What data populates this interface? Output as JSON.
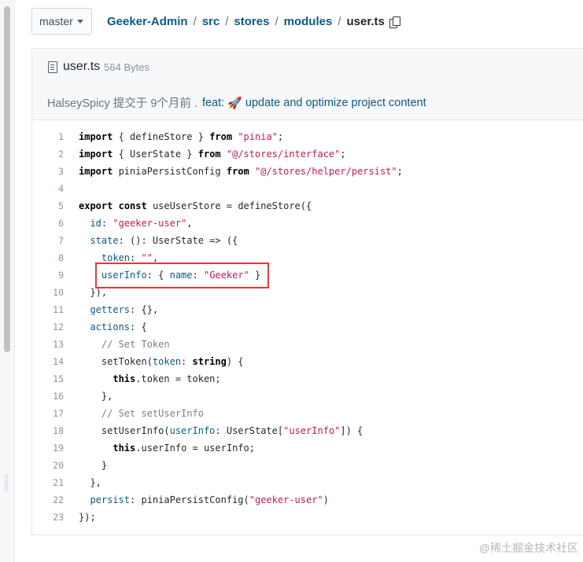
{
  "branch": {
    "label": "master"
  },
  "breadcrumb": [
    "Geeker-Admin",
    "src",
    "stores",
    "modules"
  ],
  "breadcrumb_current": "user.ts",
  "file": {
    "name": "user.ts",
    "size": "564 Bytes"
  },
  "commit": {
    "prefix": "HalseySpicy 提交于 9个月前 .",
    "type": "feat:",
    "emoji": "🚀",
    "message": "update and optimize project content"
  },
  "code": {
    "line_numbers": [
      "1",
      "2",
      "3",
      "4",
      "5",
      "6",
      "7",
      "8",
      "9",
      "10",
      "11",
      "12",
      "13",
      "14",
      "15",
      "16",
      "17",
      "18",
      "19",
      "20",
      "21",
      "22",
      "23"
    ],
    "lines": [
      [
        [
          "k",
          "import"
        ],
        [
          "t",
          " { defineStore } "
        ],
        [
          "k",
          "from"
        ],
        [
          "t",
          " "
        ],
        [
          "s",
          "\"pinia\""
        ],
        [
          "t",
          ";"
        ]
      ],
      [
        [
          "k",
          "import"
        ],
        [
          "t",
          " { UserState } "
        ],
        [
          "k",
          "from"
        ],
        [
          "t",
          " "
        ],
        [
          "s",
          "\"@/stores/interface\""
        ],
        [
          "t",
          ";"
        ]
      ],
      [
        [
          "k",
          "import"
        ],
        [
          "t",
          " piniaPersistConfig "
        ],
        [
          "k",
          "from"
        ],
        [
          "t",
          " "
        ],
        [
          "s",
          "\"@/stores/helper/persist\""
        ],
        [
          "t",
          ";"
        ]
      ],
      [],
      [
        [
          "k",
          "export"
        ],
        [
          "t",
          " "
        ],
        [
          "k",
          "const"
        ],
        [
          "t",
          " useUserStore = defineStore({"
        ]
      ],
      [
        [
          "t",
          "  "
        ],
        [
          "p",
          "id"
        ],
        [
          "t",
          ": "
        ],
        [
          "s",
          "\"geeker-user\""
        ],
        [
          "t",
          ","
        ]
      ],
      [
        [
          "t",
          "  "
        ],
        [
          "p",
          "state"
        ],
        [
          "t",
          ": (): UserState => ({"
        ]
      ],
      [
        [
          "t",
          "    "
        ],
        [
          "p",
          "token"
        ],
        [
          "t",
          ": "
        ],
        [
          "s",
          "\"\""
        ],
        [
          "t",
          ","
        ]
      ],
      [
        [
          "t",
          "    "
        ],
        [
          "p",
          "userInfo"
        ],
        [
          "t",
          ": { "
        ],
        [
          "p",
          "name"
        ],
        [
          "t",
          ": "
        ],
        [
          "s",
          "\"Geeker\""
        ],
        [
          "t",
          " }"
        ]
      ],
      [
        [
          "t",
          "  }),"
        ]
      ],
      [
        [
          "t",
          "  "
        ],
        [
          "p",
          "getters"
        ],
        [
          "t",
          ": {},"
        ]
      ],
      [
        [
          "t",
          "  "
        ],
        [
          "p",
          "actions"
        ],
        [
          "t",
          ": {"
        ]
      ],
      [
        [
          "t",
          "    "
        ],
        [
          "c",
          "// Set Token"
        ]
      ],
      [
        [
          "t",
          "    setToken("
        ],
        [
          "p",
          "token"
        ],
        [
          "t",
          ": "
        ],
        [
          "k",
          "string"
        ],
        [
          "t",
          ") {"
        ]
      ],
      [
        [
          "t",
          "      "
        ],
        [
          "k",
          "this"
        ],
        [
          "t",
          ".token = token;"
        ]
      ],
      [
        [
          "t",
          "    },"
        ]
      ],
      [
        [
          "t",
          "    "
        ],
        [
          "c",
          "// Set setUserInfo"
        ]
      ],
      [
        [
          "t",
          "    setUserInfo("
        ],
        [
          "p",
          "userInfo"
        ],
        [
          "t",
          ": UserState["
        ],
        [
          "s",
          "\"userInfo\""
        ],
        [
          "t",
          "]) {"
        ]
      ],
      [
        [
          "t",
          "      "
        ],
        [
          "k",
          "this"
        ],
        [
          "t",
          ".userInfo = userInfo;"
        ]
      ],
      [
        [
          "t",
          "    }"
        ]
      ],
      [
        [
          "t",
          "  },"
        ]
      ],
      [
        [
          "t",
          "  "
        ],
        [
          "p",
          "persist"
        ],
        [
          "t",
          ": piniaPersistConfig("
        ],
        [
          "s",
          "\"geeker-user\""
        ],
        [
          "t",
          ")"
        ]
      ],
      [
        [
          "t",
          "});"
        ]
      ]
    ]
  },
  "watermark": "@稀土掘金技术社区"
}
